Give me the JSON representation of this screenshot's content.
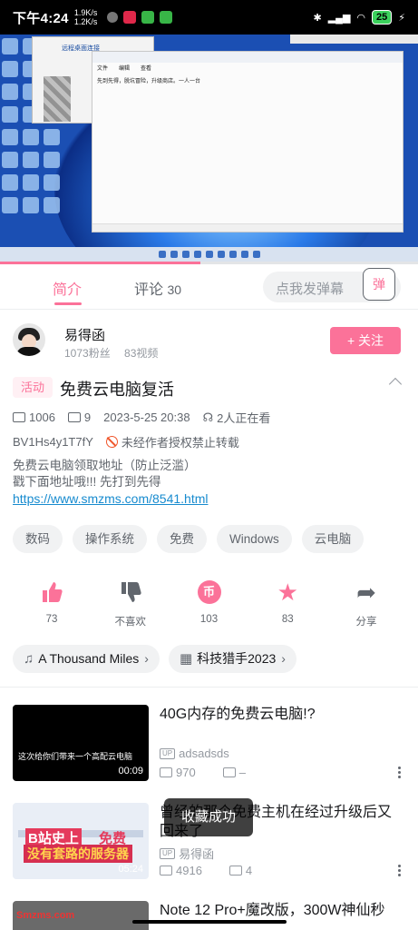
{
  "status_bar": {
    "time": "下午4:24",
    "net_up": "1.9K/s",
    "net_down": "1.2K/s",
    "battery": "25"
  },
  "player": {
    "progress_fraction": 0.48,
    "remote_title": "远程桌面连接",
    "notepad_text": "先到先得，脱坑冒险，升级商店。一人一台",
    "notepad_menu": [
      "文件",
      "编辑",
      "查看"
    ]
  },
  "tabs": {
    "intro": "简介",
    "comment": "评论",
    "comment_count": "30",
    "danmaku_placeholder": "点我发弹幕",
    "danmaku_icon": "弹"
  },
  "author": {
    "name": "易得函",
    "fans": "1073粉丝",
    "videos": "83视频",
    "follow_label": "+ 关注"
  },
  "video": {
    "tag": "活动",
    "title": "免费云电脑复活",
    "views": "1006",
    "danmaku_count": "9",
    "date": "2023-5-25 20:38",
    "watching": "2人正在看",
    "bvid": "BV1Hs4y1T7fY",
    "copyright": "未经作者授权禁止转载",
    "desc_line1": "免费云电脑领取地址（防止泛滥）",
    "desc_line2": "戳下面地址哦!!! 先打到先得",
    "desc_link": "https://www.smzms.com/8541.html"
  },
  "tags": [
    "数码",
    "操作系统",
    "免费",
    "Windows",
    "云电脑"
  ],
  "actions": {
    "like": "73",
    "dislike": "不喜欢",
    "coin": "103",
    "favorite": "83",
    "share": "分享"
  },
  "chips": {
    "music": "A Thousand Miles",
    "event": "科技猎手2023"
  },
  "related": [
    {
      "title": "40G内存的免费云电脑!?",
      "thumb_caption": "这次给你们带来一个高配云电脑",
      "duration": "00:09",
      "up": "adsadsds",
      "views": "970",
      "danmaku": "–"
    },
    {
      "title": "曾经的那个免费主机在经过升级后又回来了",
      "thumb_caption_a": "B站史上",
      "thumb_caption_b": "免费",
      "thumb_caption_c": "没有套路的服务器",
      "duration": "05:24",
      "up": "易得函",
      "views": "4916",
      "danmaku": "4"
    },
    {
      "title": "Note 12 Pro+魔改版，300W神仙秒"
    }
  ],
  "toast": "收藏成功",
  "watermark": "Smzms.com"
}
